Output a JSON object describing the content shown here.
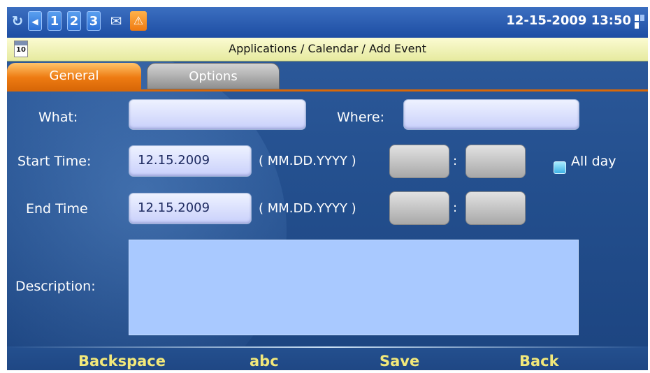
{
  "status_bar": {
    "indicators": [
      {
        "name": "refresh-icon",
        "glyph": "↻"
      },
      {
        "name": "speaker-icon",
        "glyph": "◀"
      },
      {
        "name": "line-1-icon",
        "glyph": "1"
      },
      {
        "name": "line-2-icon",
        "glyph": "2"
      },
      {
        "name": "line-3-icon",
        "glyph": "3"
      },
      {
        "name": "envelope-icon",
        "glyph": "✉"
      },
      {
        "name": "warning-icon",
        "glyph": "⚠"
      }
    ],
    "datetime": "12-15-2009 13:50",
    "network_icon": "network-bars-icon"
  },
  "breadcrumb": {
    "icon": "calendar-icon",
    "icon_day": "10",
    "text": "Applications / Calendar / Add Event"
  },
  "tabs": [
    {
      "label": "General",
      "active": true
    },
    {
      "label": "Options",
      "active": false
    }
  ],
  "form": {
    "what": {
      "label": "What:",
      "value": ""
    },
    "where": {
      "label": "Where:",
      "value": ""
    },
    "start": {
      "label": "Start Time:",
      "date": "12.15.2009",
      "format_hint": "( MM.DD.YYYY )",
      "hour": "",
      "minute": "",
      "separator": ":"
    },
    "end": {
      "label": "End Time",
      "date": "12.15.2009",
      "format_hint": "( MM.DD.YYYY )",
      "hour": "",
      "minute": "",
      "separator": ":"
    },
    "all_day": {
      "label": "All day",
      "checked": false
    },
    "description": {
      "label": "Description:",
      "value": ""
    }
  },
  "softkeys": [
    "Backspace",
    "abc",
    "Save",
    "Back"
  ],
  "colors": {
    "background": "#24508f",
    "active_tab": "#ee7b12",
    "softkey_text": "#f2e87a",
    "field": "#c9d0fb",
    "description_field": "#a9c9ff"
  }
}
